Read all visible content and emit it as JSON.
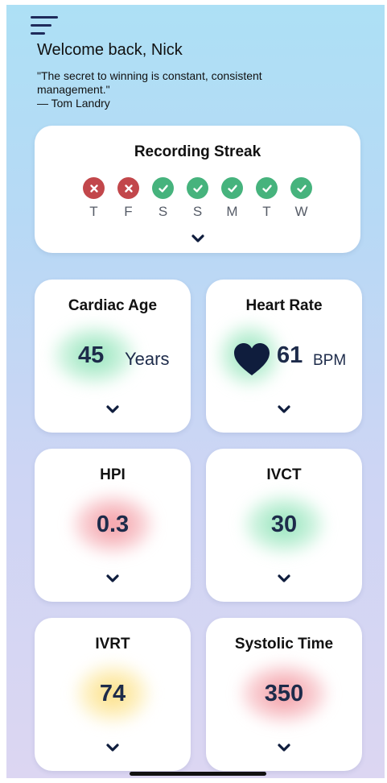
{
  "header": {
    "welcome": "Welcome back, Nick",
    "quote_text": "\"The secret to winning is constant, consistent management.\"",
    "quote_author": "— Tom Landry",
    "menu_icon": "hamburger-menu-icon"
  },
  "streak": {
    "title": "Recording Streak",
    "days": [
      {
        "letter": "T",
        "status": "missed"
      },
      {
        "letter": "F",
        "status": "missed"
      },
      {
        "letter": "S",
        "status": "recorded"
      },
      {
        "letter": "S",
        "status": "recorded"
      },
      {
        "letter": "M",
        "status": "recorded"
      },
      {
        "letter": "T",
        "status": "recorded"
      },
      {
        "letter": "W",
        "status": "recorded"
      }
    ]
  },
  "metrics": {
    "cardiac_age": {
      "title": "Cardiac Age",
      "value": "45",
      "unit": "Years"
    },
    "heart_rate": {
      "title": "Heart Rate",
      "value": "61",
      "unit": "BPM",
      "icon": "heart-icon"
    },
    "hpi": {
      "title": "HPI",
      "value": "0.3"
    },
    "ivct": {
      "title": "IVCT",
      "value": "30"
    },
    "ivrt": {
      "title": "IVRT",
      "value": "74"
    },
    "systolic_time": {
      "title": "Systolic Time",
      "value": "350"
    }
  },
  "colors": {
    "missed": "#c2474b",
    "recorded": "#46b37d",
    "value_text": "#1d2b4a",
    "glow_green": "#8fe0b6",
    "glow_red": "#f09aa3",
    "glow_yellow": "#fcd96e"
  }
}
